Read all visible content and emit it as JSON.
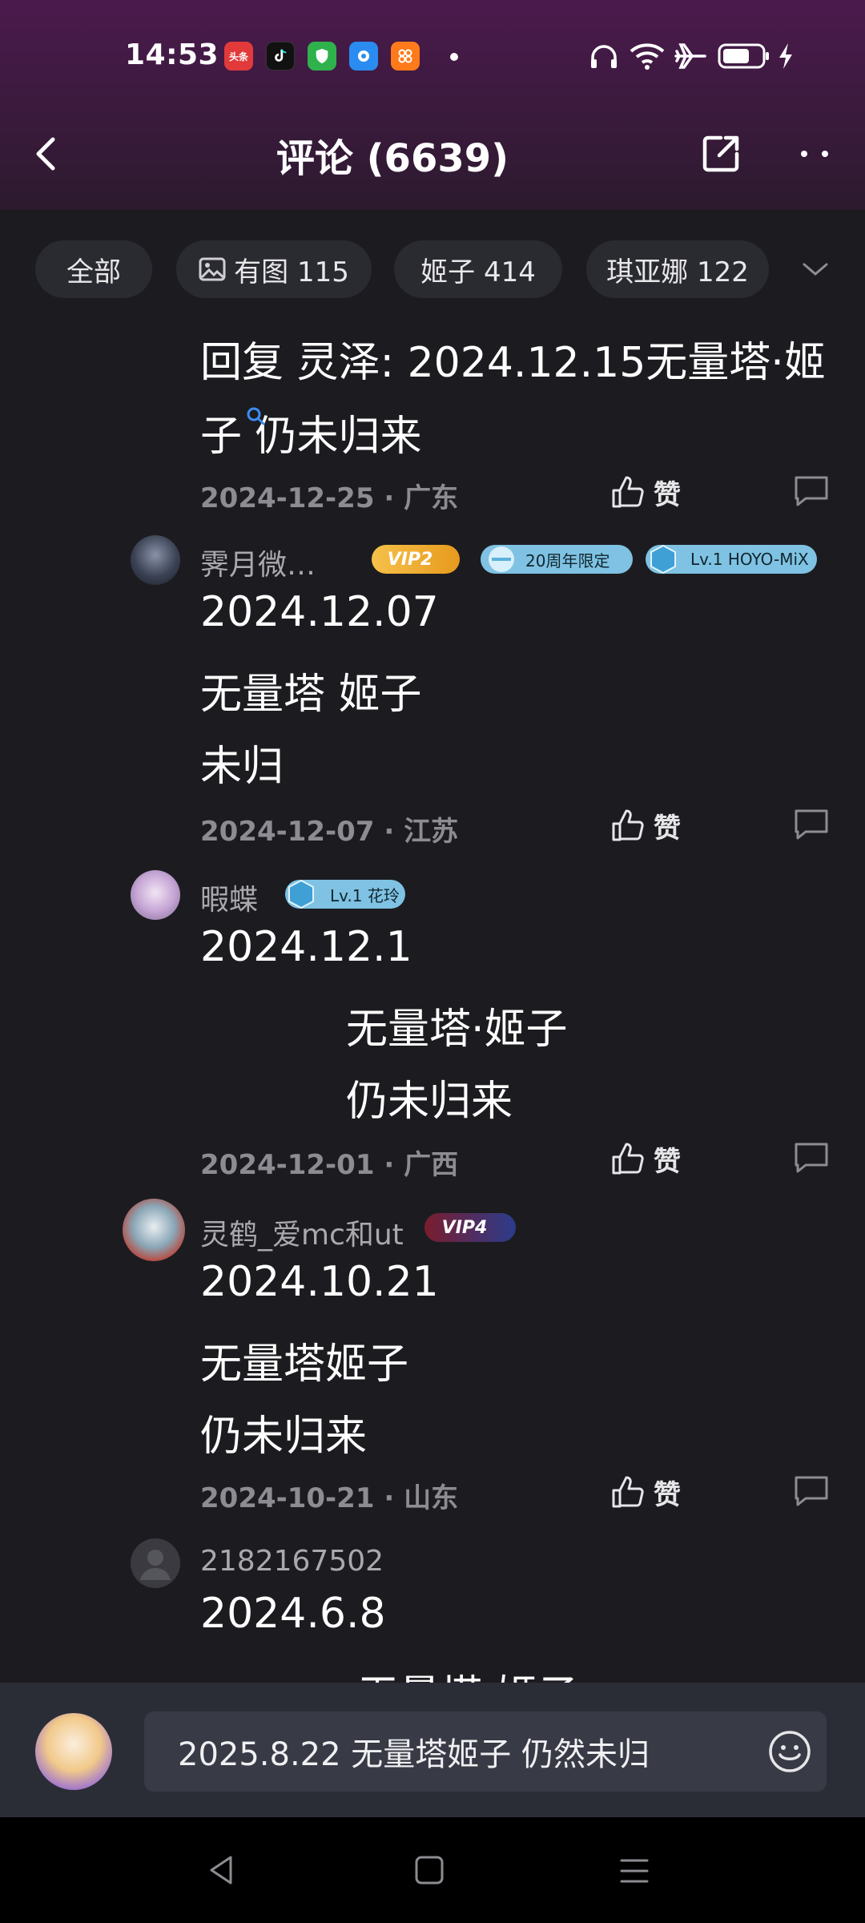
{
  "status_bar": {
    "time": "14:53",
    "apps": [
      "toutiao-app-icon",
      "tiktok-app-icon",
      "security-app-icon",
      "cloud-app-icon",
      "shop-app-icon"
    ],
    "toutiao_label": "头条",
    "right_icons": [
      "headphones-icon",
      "wifi-icon",
      "airplane-icon",
      "battery-icon",
      "charging-icon"
    ]
  },
  "nav": {
    "title": "评论 (6639)",
    "left_icon": "back-icon",
    "right_icons": [
      "share-icon",
      "more-icon"
    ]
  },
  "filters": [
    {
      "label": "全部",
      "icon": ""
    },
    {
      "label": "有图 115",
      "icon": "image-icon"
    },
    {
      "label": "姬子 414",
      "icon": ""
    },
    {
      "label": "琪亚娜 122",
      "icon": ""
    }
  ],
  "comments": [
    {
      "username": "",
      "lines": [
        "回复 灵泽: 2024.12.15无量塔·姬",
        "子 仍未归来"
      ],
      "date": "2024-12-25",
      "location": "广东",
      "like_label": "赞"
    },
    {
      "username": "霁月微…",
      "badges": [
        "VIP2",
        "20周年限定",
        "Lv.1 HOYO-MiX"
      ],
      "lines": [
        "2024.12.07",
        "无量塔 姬子",
        "未归"
      ],
      "date": "2024-12-07",
      "location": "江苏",
      "like_label": "赞"
    },
    {
      "username": "暇蝶",
      "badges": [
        "Lv.1 花玲"
      ],
      "lines": [
        "2024.12.1",
        "无量塔·姬子",
        "仍未归来"
      ],
      "date": "2024-12-01",
      "location": "广西",
      "like_label": "赞"
    },
    {
      "username": "灵鹤_爱mc和ut",
      "badges": [
        "VIP4"
      ],
      "lines": [
        "2024.10.21",
        "无量塔姬子",
        "仍未归来"
      ],
      "date": "2024-10-21",
      "location": "山东",
      "like_label": "赞"
    },
    {
      "username": "2182167502",
      "lines": [
        "2024.6.8",
        "无量塔 姬子"
      ]
    }
  ],
  "composer": {
    "input_value": "2025.8.22 无量塔姬子 仍然未归",
    "emoji_icon": "emoji-icon"
  },
  "colors": {
    "header_top": "#4b1a4d",
    "background": "#1c1c20",
    "composer": "#2b2d36",
    "badge_blue": "#7fc2e3",
    "vip_gold": "#f2b233"
  }
}
